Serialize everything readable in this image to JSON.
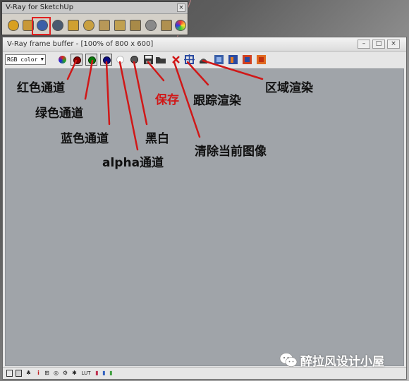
{
  "vray_toolbar": {
    "title": "V-Ray for SketchUp"
  },
  "frame_buffer": {
    "title": "V-Ray frame buffer - [100% of 800 x 600]",
    "channel_select": "RGB color"
  },
  "annotations": {
    "red_channel": "红色通道",
    "green_channel": "绿色通道",
    "blue_channel": "蓝色通道",
    "alpha_channel": "alpha通道",
    "mono": "黑白",
    "save": "保存",
    "clear_image": "清除当前图像",
    "track_render": "跟踪渲染",
    "region_render": "区域渲染"
  },
  "statusbar": {
    "lut_label": "LUT",
    "info_label": "i"
  },
  "watermark": {
    "text": "醉拉风设计小屋"
  },
  "colors": {
    "annotation_red": "#d01818",
    "highlight_red": "#e02020",
    "canvas_gray": "#a0a4a9"
  }
}
